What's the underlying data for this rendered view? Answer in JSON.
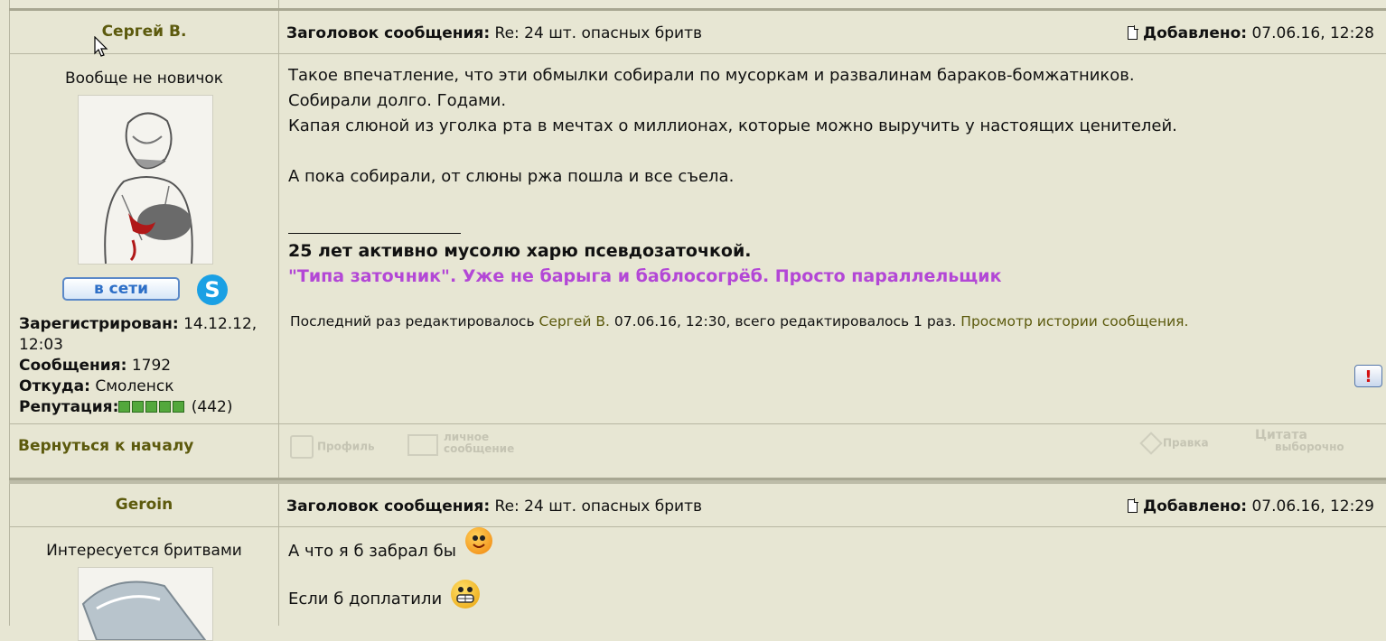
{
  "posts": [
    {
      "author": "Сергей В.",
      "subject_label": "Заголовок сообщения:",
      "subject": "Re: 24 шт. опасных бритв",
      "added_label": "Добавлено:",
      "added": "07.06.16, 12:28",
      "rank": "Вообще не новичок",
      "online_label": "в сети",
      "skype_icon": "skype-icon",
      "registered_label": "Зарегистрирован:",
      "registered": "14.12.12, 12:03",
      "messages_label": "Сообщения:",
      "messages": "1792",
      "from_label": "Откуда:",
      "from": "Смоленск",
      "reputation_label": "Репутация:",
      "reputation_count": "(442)",
      "reputation_boxes": 5,
      "body": [
        "Такое впечатление, что эти обмылки собирали по мусоркам и развалинам бараков-бомжатников.",
        "Собирали долго. Годами.",
        "Капая слюной из уголка рта в мечтах о миллионах, которые можно выручить у настоящих ценителей.",
        "",
        "А пока собирали, от слюны ржа пошла и все съела."
      ],
      "signature_line1": "25 лет активно мусолю харю псевдозаточкой.",
      "signature_line2": "\"Типа заточник\". Уже не барыга и баблосогрёб. Просто параллельщик",
      "edited_prefix": "Последний раз редактировалось",
      "edited_by": "Сергей В.",
      "edited_suffix": "07.06.16, 12:30, всего редактировалось 1 раз.",
      "edited_history": "Просмотр истории сообщения.",
      "report_label": "!",
      "back_label": "Вернуться к началу",
      "profile_label": "Профиль",
      "pm_label_1": "личное",
      "pm_label_2": "сообщение",
      "edit_label": "Правка",
      "quote_label_1": "Цитата",
      "quote_label_2": "выборочно"
    },
    {
      "author": "Geroin",
      "subject_label": "Заголовок сообщения:",
      "subject": "Re: 24 шт. опасных бритв",
      "added_label": "Добавлено:",
      "added": "07.06.16, 12:29",
      "rank": "Интересуется бритвами",
      "line1": "А что я б забрал бы",
      "line2": "Если б доплатили"
    }
  ],
  "colors": {
    "background": "#e7e6d3",
    "author": "#5c5a0d",
    "signature": "#b347d6",
    "border": "#b7b6a2"
  }
}
